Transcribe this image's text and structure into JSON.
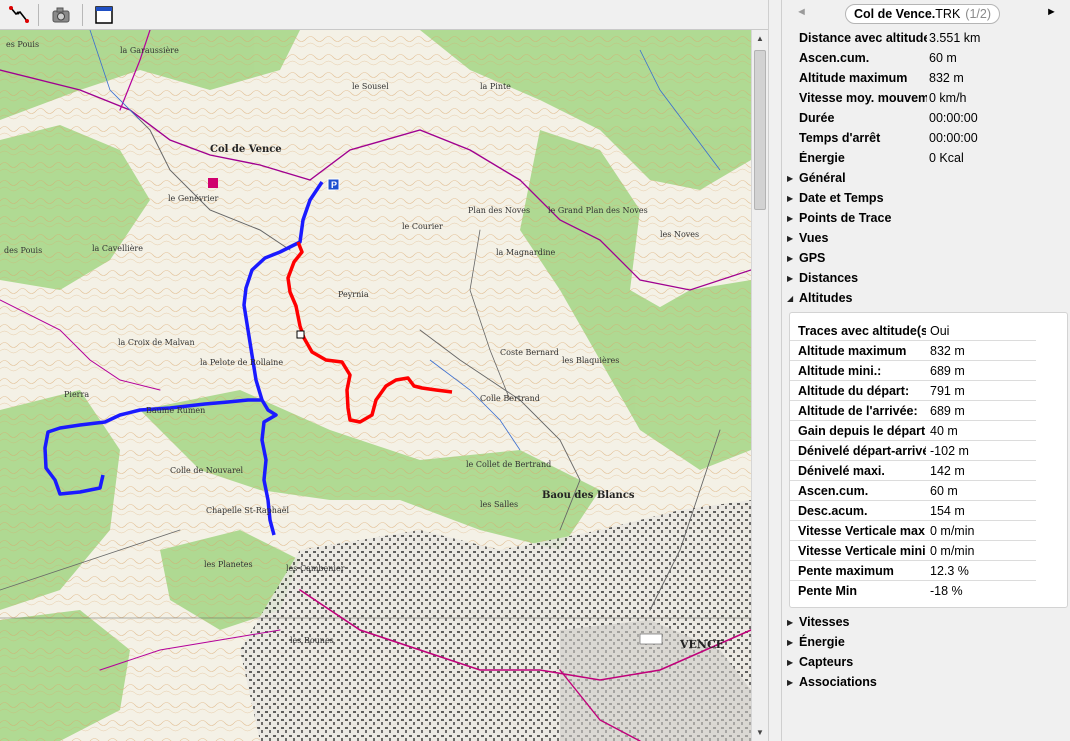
{
  "toolbar": {
    "buttons": [
      {
        "name": "track-tool-icon"
      },
      {
        "name": "camera-icon"
      },
      {
        "name": "window-icon"
      }
    ]
  },
  "map": {
    "labels": {
      "garaussiere": "la Garaussière",
      "pouis": "es Pouis",
      "col_de_vence": "Col de Vence",
      "genevrier": "le Genévrier",
      "cavelliere": "la Cavellière",
      "pouis2": "des Pouis",
      "croix_malvan": "la Croix de Malvan",
      "pelote": "la Pelote de Rollaine",
      "pierra": "Pierra",
      "baume": "Baume Rumen",
      "colle_nouvarel": "Colle de Nouvarel",
      "chapelle": "Chapelle St-Raphaël",
      "peyrnia": "Peyrnia",
      "colle_bertrand": "Colle Bertrand",
      "coste_bernard": "Coste Bernard",
      "blaquieres": "les Blaquières",
      "baou_blancs": "Baou des Blancs",
      "pinte": "la Pinte",
      "plan_noves": "Plan des Noves",
      "grand_plan": "le Grand Plan des Noves",
      "salles": "les Salles",
      "vence": "VENCE",
      "collet_bertrand": "le Collet de Bertrand",
      "courier": "le Courier",
      "magnardine": "la Magnardine",
      "sousel": "le Sousel",
      "planetes": "les Planetes",
      "cambenier": "les Cambenier",
      "bounes": "les Bounes",
      "noves": "les Noves"
    }
  },
  "panel": {
    "title": "Col de Vence.",
    "title_ext": "TRK",
    "index": "(1/2)",
    "prev_icon": "◄",
    "next_icon": "►",
    "summary": [
      {
        "label": "Distance avec altitude",
        "value": "3.551 km"
      },
      {
        "label": "Ascen.cum.",
        "value": "60 m"
      },
      {
        "label": "Altitude maximum",
        "value": "832 m"
      },
      {
        "label": "Vitesse moy. mouvement",
        "value": "0 km/h"
      },
      {
        "label": "Durée",
        "value": "00:00:00"
      },
      {
        "label": "Temps d'arrêt",
        "value": "00:00:00"
      },
      {
        "label": "Énergie",
        "value": "0 Kcal"
      }
    ],
    "sections_top": [
      {
        "name": "Général",
        "expanded": false
      },
      {
        "name": "Date et Temps",
        "expanded": false
      },
      {
        "name": "Points de Trace",
        "expanded": false
      },
      {
        "name": "Vues",
        "expanded": false
      },
      {
        "name": "GPS",
        "expanded": false
      },
      {
        "name": "Distances",
        "expanded": false
      },
      {
        "name": "Altitudes",
        "expanded": true
      }
    ],
    "altitudes": [
      {
        "label": "Traces avec altitude(s)",
        "value": "Oui"
      },
      {
        "label": "Altitude maximum",
        "value": "832 m"
      },
      {
        "label": "Altitude mini.:",
        "value": "689 m"
      },
      {
        "label": "Altitude du départ:",
        "value": "791 m"
      },
      {
        "label": "Altitude de l'arrivée:",
        "value": "689 m"
      },
      {
        "label": "Gain depuis le départ",
        "value": "40 m"
      },
      {
        "label": "Dénivelé départ-arrivée",
        "value": "-102 m"
      },
      {
        "label": "Dénivelé maxi.",
        "value": "142 m"
      },
      {
        "label": "Ascen.cum.",
        "value": "60 m"
      },
      {
        "label": "Desc.acum.",
        "value": "154 m"
      },
      {
        "label": "Vitesse Verticale max",
        "value": "0 m/min"
      },
      {
        "label": "Vitesse Verticale mini",
        "value": "0 m/min"
      },
      {
        "label": "Pente maximum",
        "value": "12.3 %"
      },
      {
        "label": "Pente Min",
        "value": "-18 %"
      }
    ],
    "sections_bottom": [
      {
        "name": "Vitesses",
        "expanded": false
      },
      {
        "name": "Énergie",
        "expanded": false
      },
      {
        "name": "Capteurs",
        "expanded": false
      },
      {
        "name": "Associations",
        "expanded": false
      }
    ],
    "arrow_collapsed": "▶",
    "arrow_expanded": "◢"
  },
  "colors": {
    "track_blue": "#1a1aff",
    "track_red": "#ff0000",
    "forest": "#9cd07a",
    "road_magenta": "#b4009a",
    "urban": "#b8b8b8"
  }
}
